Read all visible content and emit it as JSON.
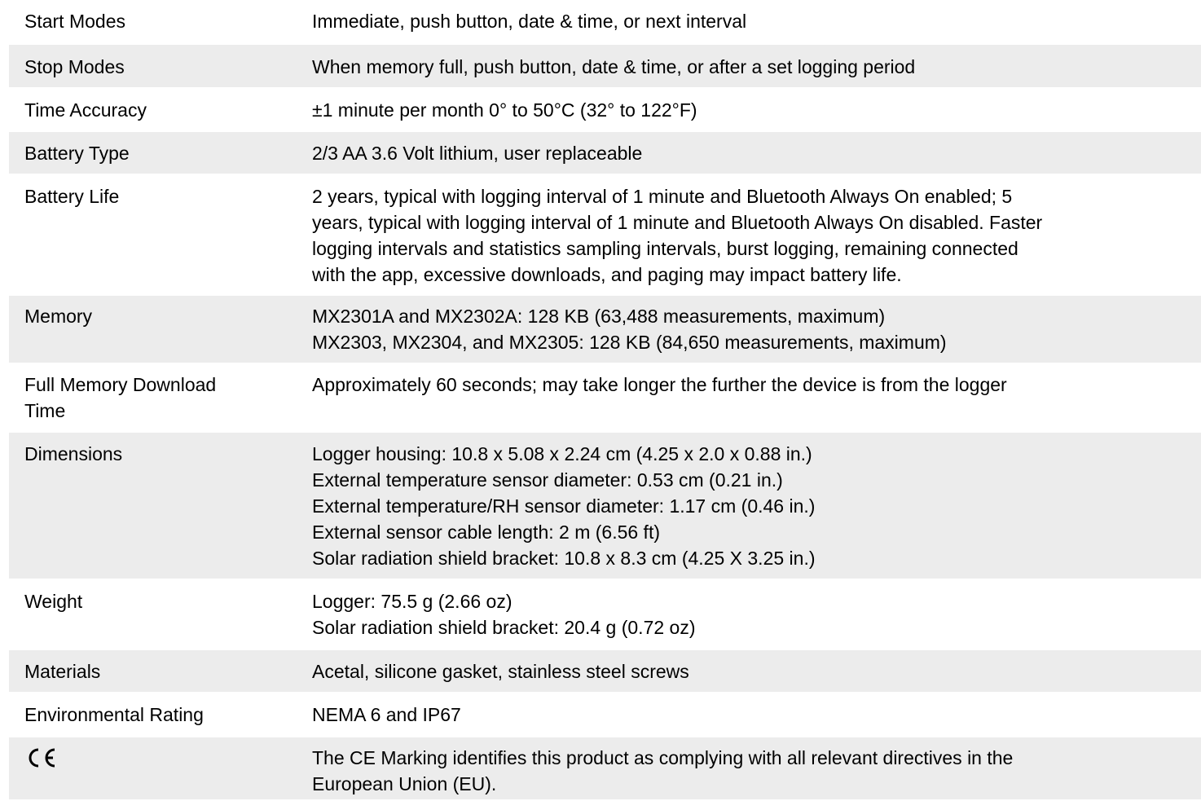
{
  "rows": [
    {
      "label": "Start Modes",
      "value": [
        "Immediate, push button, date & time, or next interval"
      ]
    },
    {
      "label": "Stop Modes",
      "value": [
        "When memory full, push button, date & time, or after a set logging period"
      ]
    },
    {
      "label": "Time Accuracy",
      "value": [
        "±1 minute per month 0° to 50°C (32° to 122°F)"
      ]
    },
    {
      "label": "Battery Type",
      "value": [
        "2/3 AA 3.6 Volt lithium, user replaceable"
      ]
    },
    {
      "label": "Battery Life",
      "value": [
        "2 years, typical with logging interval of 1 minute and Bluetooth Always On enabled; 5",
        "years, typical with logging interval of 1 minute and Bluetooth Always On disabled. Faster",
        "logging intervals and statistics sampling intervals, burst logging, remaining connected",
        "with the app, excessive downloads, and paging may impact battery life."
      ]
    },
    {
      "label": "Memory",
      "value": [
        "MX2301A and MX2302A: 128 KB (63,488 measurements, maximum)",
        "MX2303, MX2304, and MX2305: 128 KB (84,650 measurements, maximum)"
      ]
    },
    {
      "label": [
        "Full Memory Download",
        "Time"
      ],
      "value": [
        "Approximately 60 seconds; may take longer the further the device is from the logger"
      ]
    },
    {
      "label": "Dimensions",
      "value": [
        "Logger housing: 10.8 x 5.08 x 2.24 cm (4.25 x 2.0 x 0.88 in.)",
        "External temperature sensor diameter: 0.53 cm (0.21 in.)",
        "External temperature/RH sensor diameter: 1.17 cm (0.46 in.)",
        "External sensor cable length: 2 m (6.56 ft)",
        "Solar radiation shield bracket: 10.8 x 8.3 cm (4.25 X 3.25 in.)"
      ]
    },
    {
      "label": "Weight",
      "value": [
        "Logger: 75.5 g (2.66 oz)",
        "Solar radiation shield bracket: 20.4 g (0.72 oz)"
      ]
    },
    {
      "label": "Materials",
      "value": [
        "Acetal, silicone gasket, stainless steel screws"
      ]
    },
    {
      "label": "Environmental Rating",
      "value": [
        "NEMA 6 and IP67"
      ]
    },
    {
      "label_icon": "ce-marking-icon",
      "value": [
        "The CE Marking identifies this product as complying with all relevant directives in the",
        "European Union (EU)."
      ]
    }
  ],
  "colors": {
    "shaded_row": "#ececec",
    "text": "#000000"
  }
}
